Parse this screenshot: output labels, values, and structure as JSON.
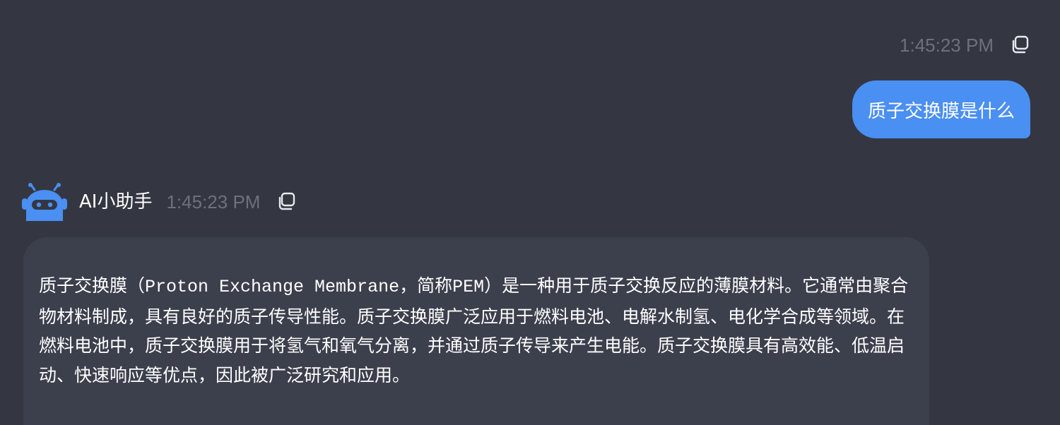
{
  "user_message": {
    "time": "1:45:23 PM",
    "text": "质子交换膜是什么",
    "copy_icon": "copy-icon",
    "bubble_color": "#4a8ff2"
  },
  "bot_message": {
    "name": "AI小助手",
    "time": "1:45:23 PM",
    "avatar_icon": "robot-icon",
    "copy_icon": "copy-icon",
    "avatar_color": "#4a8ff2",
    "text": {
      "part1": "质子交换膜（",
      "term": "Proton Exchange Membrane",
      "part2": "，简称",
      "abbr": "PEM",
      "part3": "）是一种用于质子交换反应的薄膜材料。它通常由聚合物材料制成，具有良好的质子传导性能。质子交换膜广泛应用于燃料电池、电解水制氢、电化学合成等领域。在燃料电池中，质子交换膜用于将氢气和氧气分离，并通过质子传导来产生电能。质子交换膜具有高效能、低温启动、快速响应等优点，因此被广泛研究和应用。"
    }
  },
  "colors": {
    "background": "#343742",
    "bot_bubble": "#3c3f4c",
    "timestamp": "#6d717d"
  }
}
